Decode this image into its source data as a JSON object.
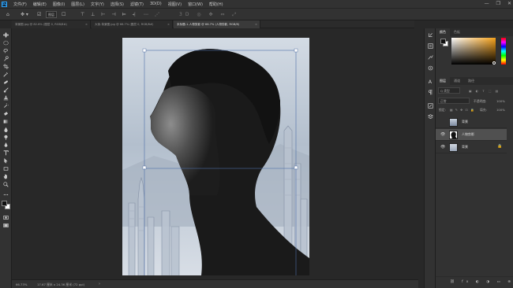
{
  "menubar": {
    "logo": "Ps",
    "items": [
      "文件(F)",
      "编辑(E)",
      "图像(I)",
      "图层(L)",
      "文字(Y)",
      "选择(S)",
      "滤镜(T)",
      "3D(D)",
      "视图(V)",
      "窗口(W)",
      "帮助(H)"
    ],
    "window_controls": [
      "—",
      "❐",
      "✕"
    ]
  },
  "options_bar": {
    "auto_select_label": "图层",
    "icons": [
      "move-icon",
      "auto-select-icon",
      "align-icons",
      "3d-mode-icons"
    ]
  },
  "tabs": [
    {
      "label": "背景图.jpg @ 82.6% (图层 0, RGB/8#)",
      "close": "×"
    },
    {
      "label": "大街-背景图.jpg @ 66.7% (图层 0, RGB/8#)",
      "close": "×"
    },
    {
      "label": "未标题-1-人物剪影 @ 66.7% (人物剪影, RGB/8)",
      "close": "×"
    }
  ],
  "status": {
    "zoom": "66.73%",
    "doc_info": "17.67 厘米 x 24.36 厘米 (72 ppi)",
    "arrow": "›"
  },
  "panels": {
    "color_tab": "颜色",
    "swatches_tab": "色板",
    "layers_tab": "图层",
    "channels_tab": "通道",
    "paths_tab": "路径",
    "kind_filter": "Q 类型",
    "blend_mode": "正常",
    "opacity_label": "不透明度:",
    "opacity_value": "100%",
    "lock_label": "锁定:",
    "fill_label": "填充:",
    "fill_value": "100%",
    "layers": [
      {
        "name": "背景",
        "visible": false,
        "locked": false
      },
      {
        "name": "人物剪影",
        "visible": true,
        "selected": true
      },
      {
        "name": "背景",
        "visible": true,
        "locked": true
      }
    ]
  },
  "colors": {
    "accent": "#31a8ff",
    "foreground": "#111111",
    "background": "#ffffff",
    "picker_hue": "#f6a21a"
  }
}
